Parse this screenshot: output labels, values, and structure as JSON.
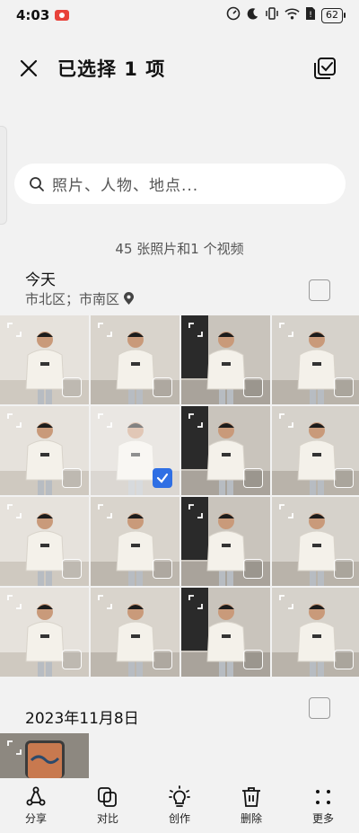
{
  "status": {
    "time": "4:03",
    "battery": "62",
    "icons": [
      "screen-record-icon",
      "speed-icon",
      "moon-icon",
      "vibrate-icon",
      "wifi-icon",
      "sim-alert-icon",
      "battery-icon"
    ]
  },
  "header": {
    "title": "已选择 1 项",
    "close_icon": "close-icon",
    "select_all_icon": "select-all-icon"
  },
  "search": {
    "placeholder": "照片、人物、地点..."
  },
  "summary": "45 张照片和1 个视频",
  "groups": [
    {
      "title": "今天",
      "location": "市北区；市南区",
      "selected_index": 5,
      "photo_count_shown": 16
    },
    {
      "title": "2023年11月8日"
    }
  ],
  "bottom_bar": [
    {
      "label": "分享",
      "icon": "share-icon"
    },
    {
      "label": "对比",
      "icon": "compare-icon"
    },
    {
      "label": "创作",
      "icon": "create-icon"
    },
    {
      "label": "删除",
      "icon": "delete-icon"
    },
    {
      "label": "更多",
      "icon": "more-icon"
    }
  ],
  "colors": {
    "background": "#f2f2f2",
    "accent": "#2f6fe4"
  }
}
